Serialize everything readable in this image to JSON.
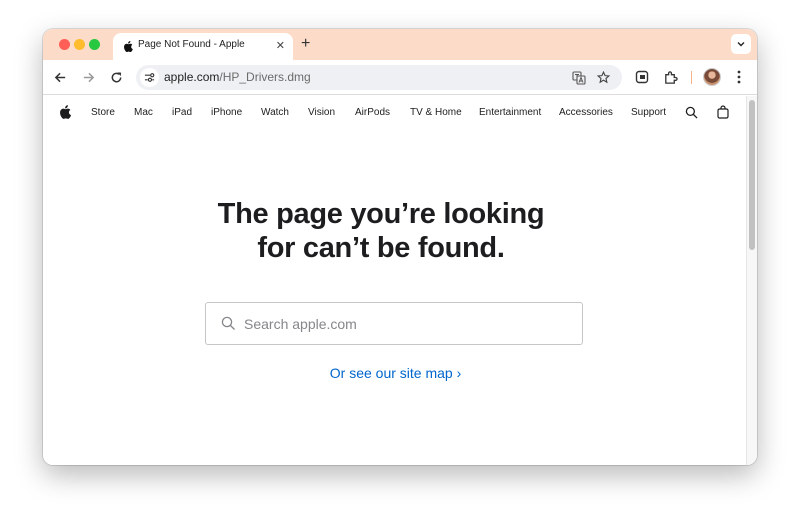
{
  "browser": {
    "tab": {
      "title": "Page Not Found - Apple",
      "close_glyph": "✕"
    },
    "new_tab_glyph": "+",
    "address": {
      "host": "apple.com",
      "path": "/HP_Drivers.dmg"
    },
    "icons": [
      "back-arrow-icon",
      "forward-arrow-icon",
      "reload-icon",
      "site-info-icon",
      "translate-icon",
      "bookmark-star-icon",
      "extension-icon",
      "puzzle-extensions-icon",
      "profile-avatar",
      "more-menu-icon",
      "tab-search-icon"
    ],
    "colors": {
      "tabstrip": "#fcdcc8",
      "omnibox": "#eef0f3"
    }
  },
  "globalnav": {
    "items": [
      "Store",
      "Mac",
      "iPad",
      "iPhone",
      "Watch",
      "Vision",
      "AirPods",
      "TV & Home",
      "Entertainment",
      "Accessories",
      "Support"
    ],
    "icons": [
      "apple-logo-icon",
      "search-icon",
      "bag-icon"
    ]
  },
  "main": {
    "headline_line1": "The page you’re looking",
    "headline_line2": "for can’t be found.",
    "search_placeholder": "Search apple.com",
    "sitemap_link": "Or see our site map ›",
    "colors": {
      "link": "#0066cc",
      "text": "#1d1d1f"
    }
  }
}
